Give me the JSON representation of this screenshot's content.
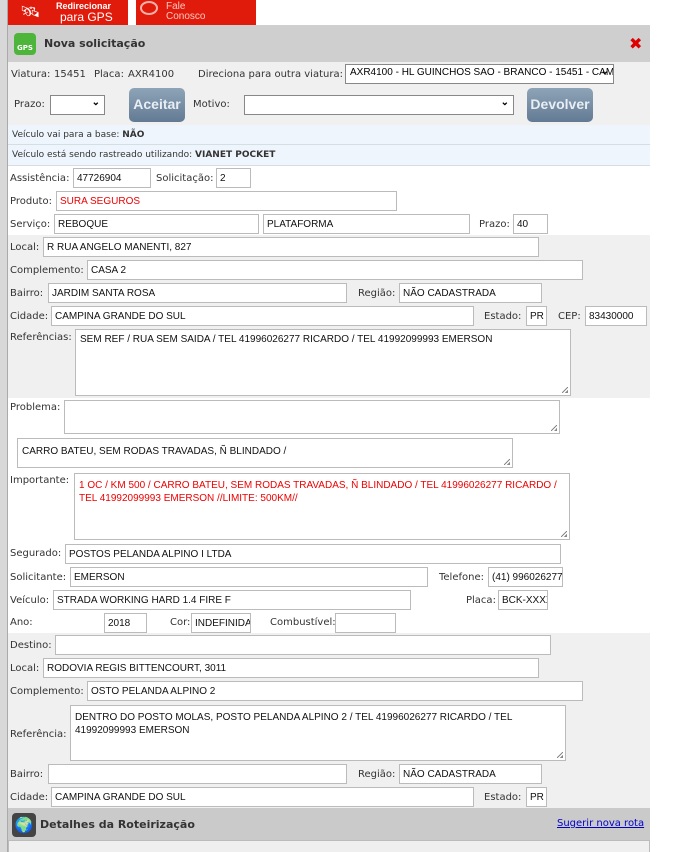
{
  "top_tabs": [
    {
      "label_line1": "Redirecionar",
      "label_line2": "para GPS"
    },
    {
      "label_line1": "Fale",
      "label_line2": "Conosco"
    }
  ],
  "dialog": {
    "title": "Nova solicitação",
    "close_icon": "close-icon"
  },
  "vehicle": {
    "viatura_label": "Viatura:",
    "viatura": "15451",
    "placa_label": "Placa:",
    "placa": "AXR4100",
    "redirect_label": "Direciona para outra viatura:",
    "redirect_value": "AXR4100 - HL GUINCHOS SAO - BRANCO - 15451 - CAM"
  },
  "actions": {
    "prazo_label": "Prazo:",
    "prazo_value": "",
    "accept": "Aceitar",
    "motivo_label": "Motivo:",
    "motivo_value": "",
    "return": "Devolver"
  },
  "info": {
    "base_label": "Veículo vai para a base:",
    "base_value": "NÃO",
    "track_label": "Veículo está sendo rastreado utilizando:",
    "track_value": "VIANET POCKET"
  },
  "form": {
    "assistencia_label": "Assistência:",
    "assistencia": "47726904",
    "solicitacao_label": "Solicitação:",
    "solicitacao": "2",
    "produto_label": "Produto:",
    "produto": "SURA SEGUROS",
    "servico_label": "Serviço:",
    "servico": "REBOQUE",
    "servico2": "PLATAFORMA",
    "prazo_label": "Prazo:",
    "prazo": "40",
    "local_label": "Local:",
    "local": "R RUA ANGELO MANENTI, 827",
    "complemento_label": "Complemento:",
    "complemento": "CASA 2",
    "bairro_label": "Bairro:",
    "bairro": "JARDIM SANTA ROSA",
    "regiao_label": "Região:",
    "regiao": "NÃO CADASTRADA",
    "cidade_label": "Cidade:",
    "cidade": "CAMPINA GRANDE DO SUL",
    "estado_label": "Estado:",
    "estado": "PR",
    "cep_label": "CEP:",
    "cep": "83430000",
    "referencias_label": "Referências:",
    "referencias": "SEM REF / RUA SEM SAIDA /   TEL 41996026277 RICARDO  / TEL 41992099993 EMERSON",
    "problema_label": "Problema:",
    "problema": "",
    "descricao": "CARRO BATEU, SEM RODAS TRAVADAS, Ñ BLINDADO /",
    "importante_label": "Importante:",
    "importante": "1 OC / KM 500 /  CARRO BATEU, SEM RODAS TRAVADAS, Ñ BLINDADO / TEL 41996026277 RICARDO  / TEL 41992099993 EMERSON //LIMITE: 500KM//",
    "segurado_label": "Segurado:",
    "segurado": "POSTOS PELANDA ALPINO I LTDA",
    "solicitante_label": "Solicitante:",
    "solicitante": "EMERSON",
    "telefone_label": "Telefone:",
    "telefone": "(41) 996026277",
    "veiculo_label": "Veículo:",
    "veiculo": "STRADA WORKING HARD 1.4 FIRE F",
    "placa_label": "Placa:",
    "placa": "BCK-XXXX",
    "ano_label": "Ano:",
    "ano": "2018",
    "cor_label": "Cor:",
    "cor": "INDEFINIDA",
    "combustivel_label": "Combustível:",
    "combustivel": ""
  },
  "destino": {
    "destino_label": "Destino:",
    "destino": "",
    "local_label": "Local:",
    "local": "RODOVIA REGIS BITTENCOURT, 3011",
    "complemento_label": "Complemento:",
    "complemento": "OSTO PELANDA ALPINO 2",
    "referencia_label": "Referência:",
    "referencia": "DENTRO DO POSTO MOLAS, POSTO PELANDA ALPINO 2 /  TEL 41996026277 RICARDO  / TEL 41992099993 EMERSON",
    "bairro_label": "Bairro:",
    "bairro": "",
    "regiao_label": "Região:",
    "regiao": "NÃO CADASTRADA",
    "cidade_label": "Cidade:",
    "cidade": "CAMPINA GRANDE DO SUL",
    "estado_label": "Estado:",
    "estado": "PR"
  },
  "routing": {
    "title": "Detalhes da Roteirização",
    "link": "Sugerir nova rota"
  }
}
